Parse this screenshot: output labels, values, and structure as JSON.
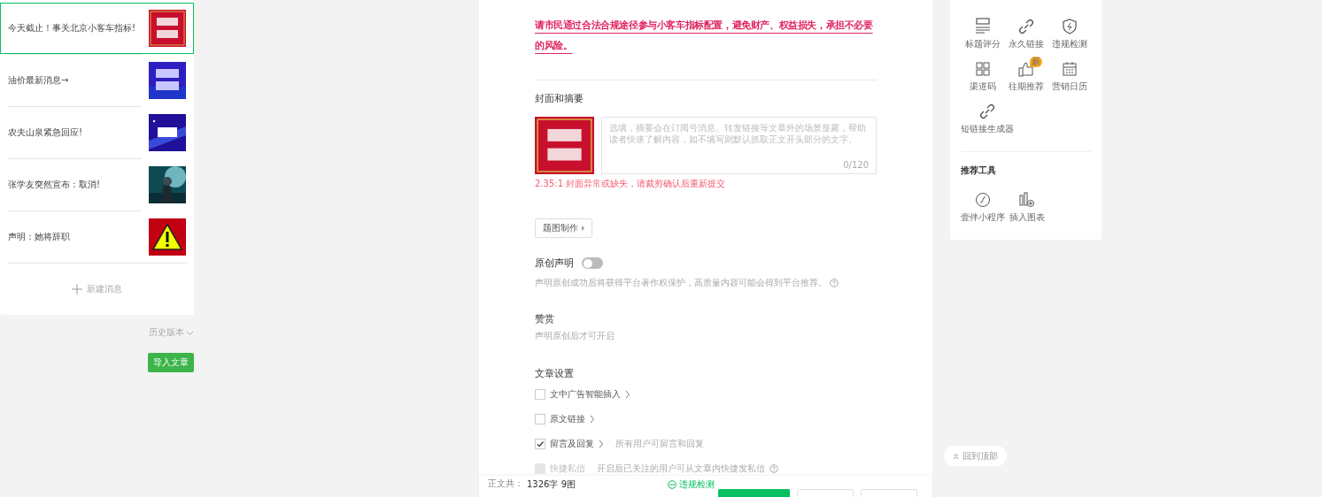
{
  "articles": [
    {
      "title": "今天截止！事关北京小客车指标!",
      "selected": true
    },
    {
      "title": "油价最新消息→",
      "selected": false
    },
    {
      "title": "农夫山泉紧急回应!",
      "selected": false
    },
    {
      "title": "张学友突然宣布：取消!",
      "selected": false
    },
    {
      "title": "声明：她将辞职",
      "selected": false
    }
  ],
  "new_message": "新建消息",
  "history": "历史版本",
  "import_button": "导入文章",
  "notice": "请市民通过合法合规途径参与小客车指标配置，避免财产、权益损失，承担不必要的风险。",
  "cover_section": {
    "title": "封面和摘要",
    "summary": {
      "placeholder": "选填，摘要会在订阅号消息、转发链接等文章外的场景显露，帮助读者快速了解内容，如不填写则默认抓取正文开头部分的文字。",
      "counter": "0/120"
    },
    "error": "2.35:1 封面异常或缺失，请裁剪确认后重新提交",
    "make_button": "题图制作"
  },
  "original": {
    "title": "原创声明",
    "on": false,
    "description": "声明原创成功后将获得平台著作权保护，高质量内容可能会得到平台推荐。"
  },
  "reward": {
    "title": "赞赏",
    "description": "声明原创后才可开启"
  },
  "settings": {
    "title": "文章设置",
    "options": [
      {
        "label": "文中广告智能插入",
        "checked": false,
        "disabled": false,
        "expandable": true
      },
      {
        "label": "原文链接",
        "checked": false,
        "disabled": false,
        "expandable": true
      },
      {
        "label": "留言及回复",
        "checked": true,
        "disabled": false,
        "expandable": true,
        "hint": "所有用户可留言和回复"
      },
      {
        "label": "快捷私信",
        "checked": false,
        "disabled": true,
        "expandable": false,
        "hint": "开启后已关注的用户可从文章内快捷发私信"
      }
    ]
  },
  "footer": {
    "word_count_label": "正文共：",
    "word_count": "1326字 9图",
    "check_link": "违规检测"
  },
  "tools": {
    "items": [
      {
        "label": "标题评分"
      },
      {
        "label": "永久链接"
      },
      {
        "label": "违规检测"
      },
      {
        "label": "渠道码"
      },
      {
        "label": "往期推荐",
        "badge": "新"
      },
      {
        "label": "营销日历"
      },
      {
        "label": "短链接生成器"
      }
    ]
  },
  "recommended": {
    "title": "推荐工具",
    "items": [
      {
        "label": "壹伴小程序"
      },
      {
        "label": "插入图表"
      }
    ]
  },
  "back_to_top": "回到顶部"
}
